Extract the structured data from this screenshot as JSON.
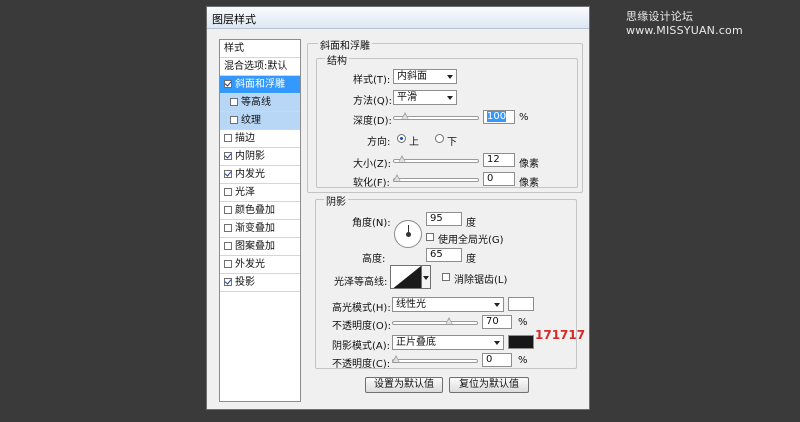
{
  "watermark": "思缘设计论坛 www.MISSYUAN.com",
  "dialog": {
    "title": "图层样式"
  },
  "style_list": {
    "header": "样式",
    "blend_default": "混合选项:默认",
    "items": [
      {
        "label": "斜面和浮雕",
        "checked": true
      },
      {
        "label": "等高线",
        "checked": false
      },
      {
        "label": "纹理",
        "checked": false
      },
      {
        "label": "描边",
        "checked": false
      },
      {
        "label": "内阴影",
        "checked": true
      },
      {
        "label": "内发光",
        "checked": true
      },
      {
        "label": "光泽",
        "checked": false
      },
      {
        "label": "颜色叠加",
        "checked": false
      },
      {
        "label": "渐变叠加",
        "checked": false
      },
      {
        "label": "图案叠加",
        "checked": false
      },
      {
        "label": "外发光",
        "checked": false
      },
      {
        "label": "投影",
        "checked": true
      }
    ]
  },
  "bevel": {
    "group_title": "斜面和浮雕",
    "structure_title": "结构",
    "style_label": "样式(T):",
    "style_value": "内斜面",
    "technique_label": "方法(Q):",
    "technique_value": "平滑",
    "depth_label": "深度(D):",
    "depth_value": "100",
    "depth_unit": "%",
    "depth_level": 0.1,
    "direction_label": "方向:",
    "direction_up": "上",
    "direction_down": "下",
    "direction_selected": "up",
    "size_label": "大小(Z):",
    "size_value": "12",
    "size_unit": "像素",
    "size_level": 0.06,
    "soften_label": "软化(F):",
    "soften_value": "0",
    "soften_unit": "像素",
    "soften_level": 0
  },
  "shading": {
    "group_title": "阴影",
    "angle_label": "角度(N):",
    "angle_value": "95",
    "angle_unit": "度",
    "global_light_label": "使用全局光(G)",
    "global_light_checked": false,
    "altitude_label": "高度:",
    "altitude_value": "65",
    "altitude_unit": "度",
    "gloss_label": "光泽等高线:",
    "antialias_label": "消除锯齿(L)",
    "antialias_checked": false,
    "highlight_mode_label": "高光模式(H):",
    "highlight_mode_value": "线性光",
    "highlight_color": "#ffffff",
    "highlight_opacity_label": "不透明度(O):",
    "highlight_opacity_value": "70",
    "highlight_opacity_unit": "%",
    "highlight_opacity_level": 0.7,
    "shadow_mode_label": "阴影模式(A):",
    "shadow_mode_value": "正片叠底",
    "shadow_color": "#171717",
    "shadow_opacity_label": "不透明度(C):",
    "shadow_opacity_value": "0",
    "shadow_opacity_unit": "%",
    "shadow_opacity_level": 0
  },
  "buttons": {
    "make_default": "设置为默认值",
    "reset_default": "复位为默认值"
  },
  "annotation": "171717"
}
